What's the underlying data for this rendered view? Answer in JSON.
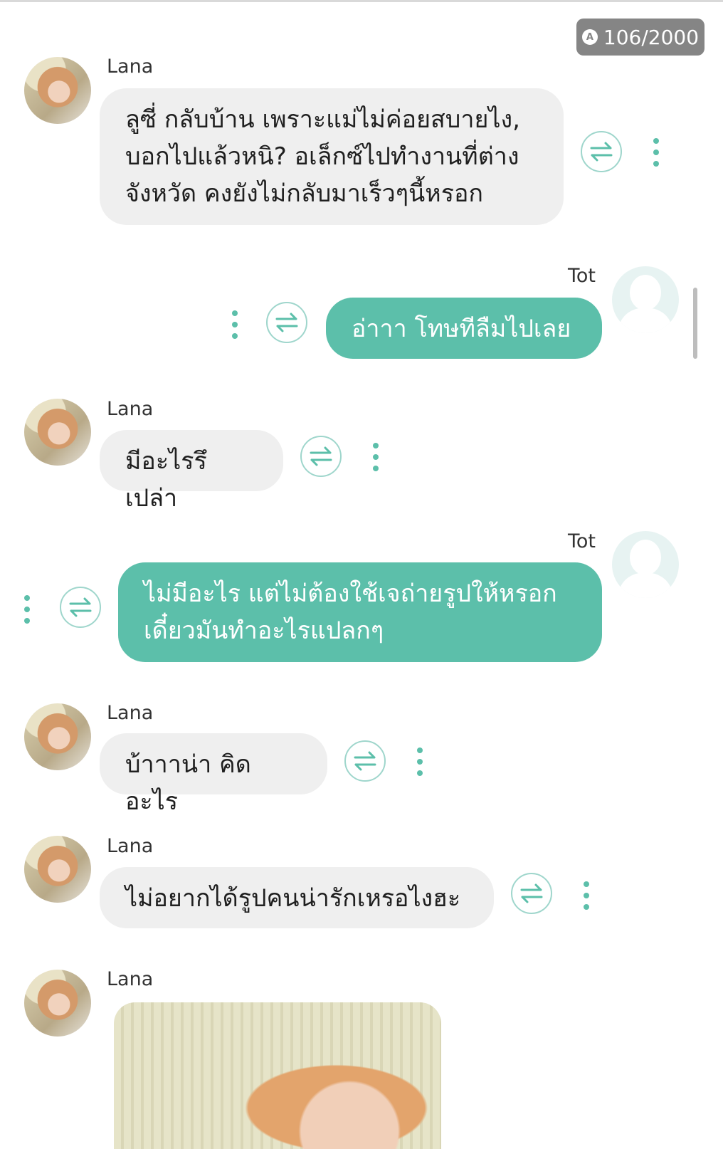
{
  "counter": {
    "icon": "a-badge-icon",
    "text": "106/2000"
  },
  "messages": [
    {
      "sender": "Lana",
      "text": "ลูซี่ กลับบ้าน เพราะแม่ไม่ค่อยสบายไง,\nบอกไปแล้วหนิ? อเล็กซ์ไปทำงานที่ต่าง\nจังหวัด คงยังไม่กลับมาเร็วๆนี้หรอก"
    },
    {
      "sender": "Tot",
      "text": "อ่าาา โทษทีลืมไปเลย"
    },
    {
      "sender": "Lana",
      "text": "มีอะไรรึเปล่า"
    },
    {
      "sender": "Tot",
      "text": "ไม่มีอะไร แต่ไม่ต้องใช้เจถ่ายรูปให้หรอก\nเดี๋ยวมันทำอะไรแปลกๆ"
    },
    {
      "sender": "Lana",
      "text": "บ้าาาน่า คิดอะไร"
    },
    {
      "sender": "Lana",
      "text": "ไม่อยากได้รูปคนน่ารักเหรอไงฮะ"
    },
    {
      "sender": "Lana",
      "text": ""
    }
  ],
  "colors": {
    "accent": "#5cbfaa",
    "incoming_bubble": "#efefef",
    "counter_bg": "#858585"
  }
}
